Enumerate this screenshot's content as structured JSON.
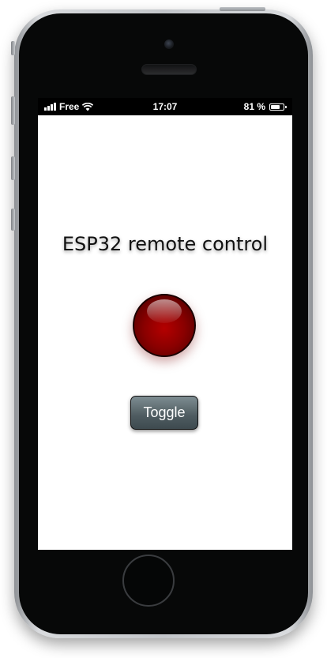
{
  "status_bar": {
    "carrier": "Free",
    "time": "17:07",
    "battery_percent": "81 %",
    "battery_level": 0.81,
    "icons": [
      "signal-icon",
      "wifi-icon",
      "battery-icon"
    ]
  },
  "app": {
    "title": "ESP32 remote control",
    "led_state": "off",
    "led_color": "#8a0000",
    "toggle_label": "Toggle",
    "toggle_color": "#4e5b60"
  },
  "device": {
    "frame_color": "#c3c6ca",
    "body_color": "#070808"
  }
}
